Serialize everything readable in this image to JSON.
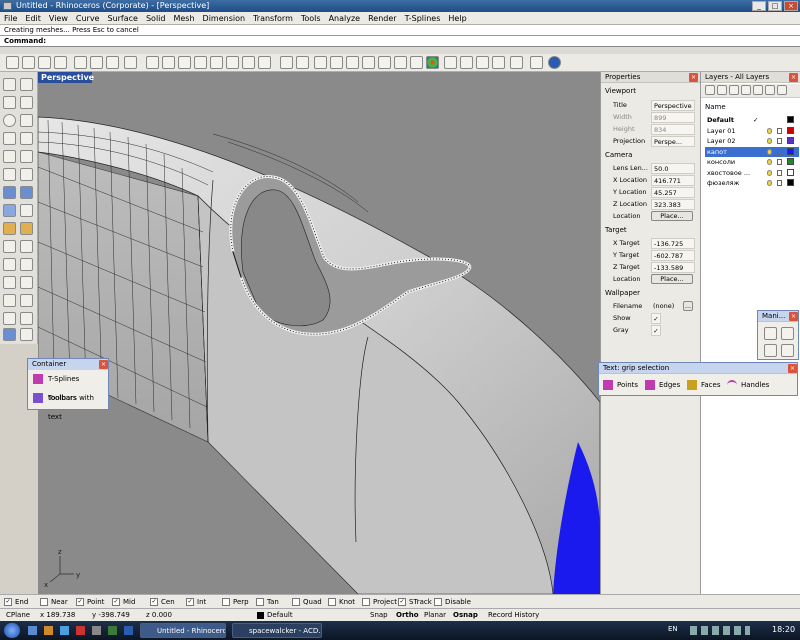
{
  "window": {
    "title": "Untitled - Rhinoceros (Corporate) - [Perspective]",
    "min": "_",
    "max": "□",
    "close": "×"
  },
  "menu": [
    "File",
    "Edit",
    "View",
    "Curve",
    "Surface",
    "Solid",
    "Mesh",
    "Dimension",
    "Transform",
    "Tools",
    "Analyze",
    "Render",
    "T-Splines",
    "Help"
  ],
  "command": {
    "history": "Creating meshes... Press Esc to cancel",
    "prompt": "Command:"
  },
  "viewport": {
    "label": "Perspective",
    "axis": {
      "x": "x",
      "y": "y",
      "z": "z"
    }
  },
  "container": {
    "title": "Container",
    "items": [
      "T-Splines toolbars",
      "Toolbars with text"
    ]
  },
  "properties": {
    "title": "Properties",
    "viewport_section": "Viewport",
    "title_label": "Title",
    "title_value": "Perspective",
    "width_label": "Width",
    "width_value": "899",
    "height_label": "Height",
    "height_value": "834",
    "projection_label": "Projection",
    "projection_value": "Perspe...",
    "camera_section": "Camera",
    "lens_label": "Lens Len...",
    "lens_value": "50.0",
    "xloc_label": "X Location",
    "xloc_value": "416.771",
    "yloc_label": "Y Location",
    "yloc_value": "45.257",
    "zloc_label": "Z Location",
    "zloc_value": "323.383",
    "location_label": "Location",
    "place_button": "Place...",
    "target_section": "Target",
    "xt_label": "X Target",
    "xt_value": "-136.725",
    "yt_label": "Y Target",
    "yt_value": "-602.787",
    "zt_label": "Z Target",
    "zt_value": "-133.589",
    "tlocation_label": "Location",
    "tplace_button": "Place...",
    "wallpaper_section": "Wallpaper",
    "filename_label": "Filename",
    "filename_value": "(none)",
    "browse_button": "...",
    "show_label": "Show",
    "gray_label": "Gray",
    "check": "✓"
  },
  "layers": {
    "title": "Layers - All Layers",
    "name_header": "Name",
    "current_mark": "✓",
    "items": [
      {
        "name": "Default",
        "color": "#000000",
        "bold": true
      },
      {
        "name": "Layer 01",
        "color": "#cc0000"
      },
      {
        "name": "Layer 02",
        "color": "#5533cc"
      },
      {
        "name": "капот",
        "color": "#1a1aee",
        "selected": true
      },
      {
        "name": "консоли",
        "color": "#1f8a2a"
      },
      {
        "name": "хвостовое ...",
        "color": "#ffffff"
      },
      {
        "name": "фюзеляж",
        "color": "#000000"
      }
    ]
  },
  "manipulator": {
    "title": "Mani..."
  },
  "textgrip": {
    "title": "Text: grip selection",
    "buttons": [
      "Points",
      "Edges",
      "Faces",
      "Handles"
    ]
  },
  "osnap": [
    {
      "label": "End",
      "checked": true
    },
    {
      "label": "Near",
      "checked": false
    },
    {
      "label": "Point",
      "checked": true
    },
    {
      "label": "Mid",
      "checked": true
    },
    {
      "label": "Cen",
      "checked": true
    },
    {
      "label": "Int",
      "checked": true
    },
    {
      "label": "Perp",
      "checked": false
    },
    {
      "label": "Tan",
      "checked": false
    },
    {
      "label": "Quad",
      "checked": false
    },
    {
      "label": "Knot",
      "checked": false
    },
    {
      "label": "Project",
      "checked": false
    },
    {
      "label": "STrack",
      "checked": true
    },
    {
      "label": "Disable",
      "checked": false
    }
  ],
  "status": {
    "cplane": "CPlane",
    "x": "x 189.738",
    "y": "y -398.749",
    "z": "z 0.000",
    "layer": "Default",
    "snap": "Snap",
    "ortho": "Ortho",
    "planar": "Planar",
    "osnap": "Osnap",
    "history": "Record History"
  },
  "taskbar": {
    "tasks": [
      "Untitled - Rhinoceros ...",
      "spacewalcker - ACD..."
    ],
    "lang": "EN",
    "time": "18:20"
  },
  "colors": {
    "fuselage": "#d2d2d2",
    "blue_patch": "#1a1aee",
    "background": "#8a8a8a"
  }
}
